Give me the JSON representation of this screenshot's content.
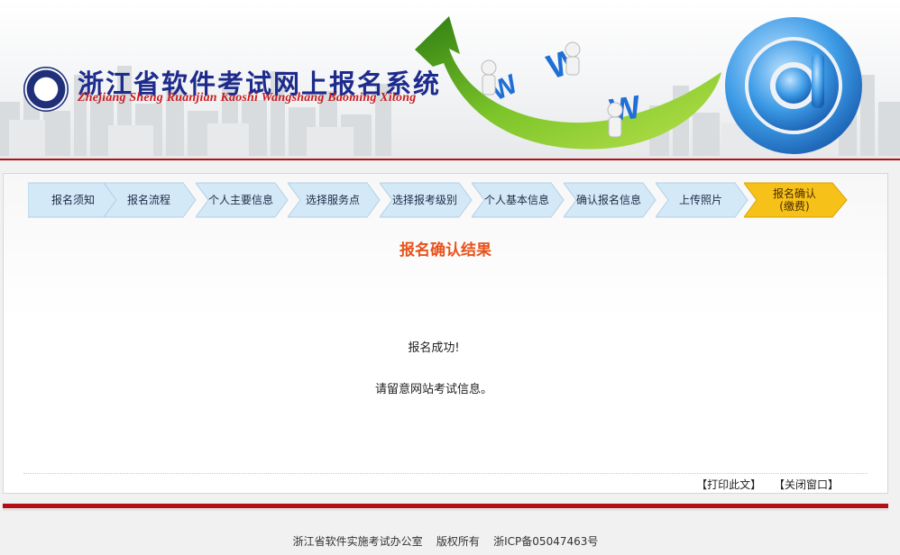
{
  "header": {
    "title": "浙江省软件考试网上报名系统",
    "subtitle": "Zhejiang Sheng Ruanjian Kaoshi Wangshang Baoming Xitong"
  },
  "steps": [
    {
      "label": "报名须知",
      "active": false
    },
    {
      "label": "报名流程",
      "active": false
    },
    {
      "label": "个人主要信息",
      "active": false
    },
    {
      "label": "选择服务点",
      "active": false
    },
    {
      "label": "选择报考级别",
      "active": false
    },
    {
      "label": "个人基本信息",
      "active": false
    },
    {
      "label": "确认报名信息",
      "active": false
    },
    {
      "label": "上传照片",
      "active": false
    },
    {
      "label": "报名确认\n(缴费)",
      "active": true
    }
  ],
  "result": {
    "title": "报名确认结果",
    "message_success": "报名成功!",
    "message_notice": "请留意网站考试信息。"
  },
  "actions": {
    "print": "【打印此文】",
    "close": "【关闭窗口】"
  },
  "footer": {
    "text": "浙江省软件实施考试办公室    版权所有    浙ICP备05047463号"
  },
  "colors": {
    "brand_red": "#b30f14",
    "title_blue": "#1d2b8c",
    "result_orange": "#e8521a",
    "step_blue": "#cfe6f7",
    "step_active": "#f6c21a"
  },
  "icons": [
    "logo-seal",
    "at-sign-icon",
    "www-arrow-graphic"
  ]
}
